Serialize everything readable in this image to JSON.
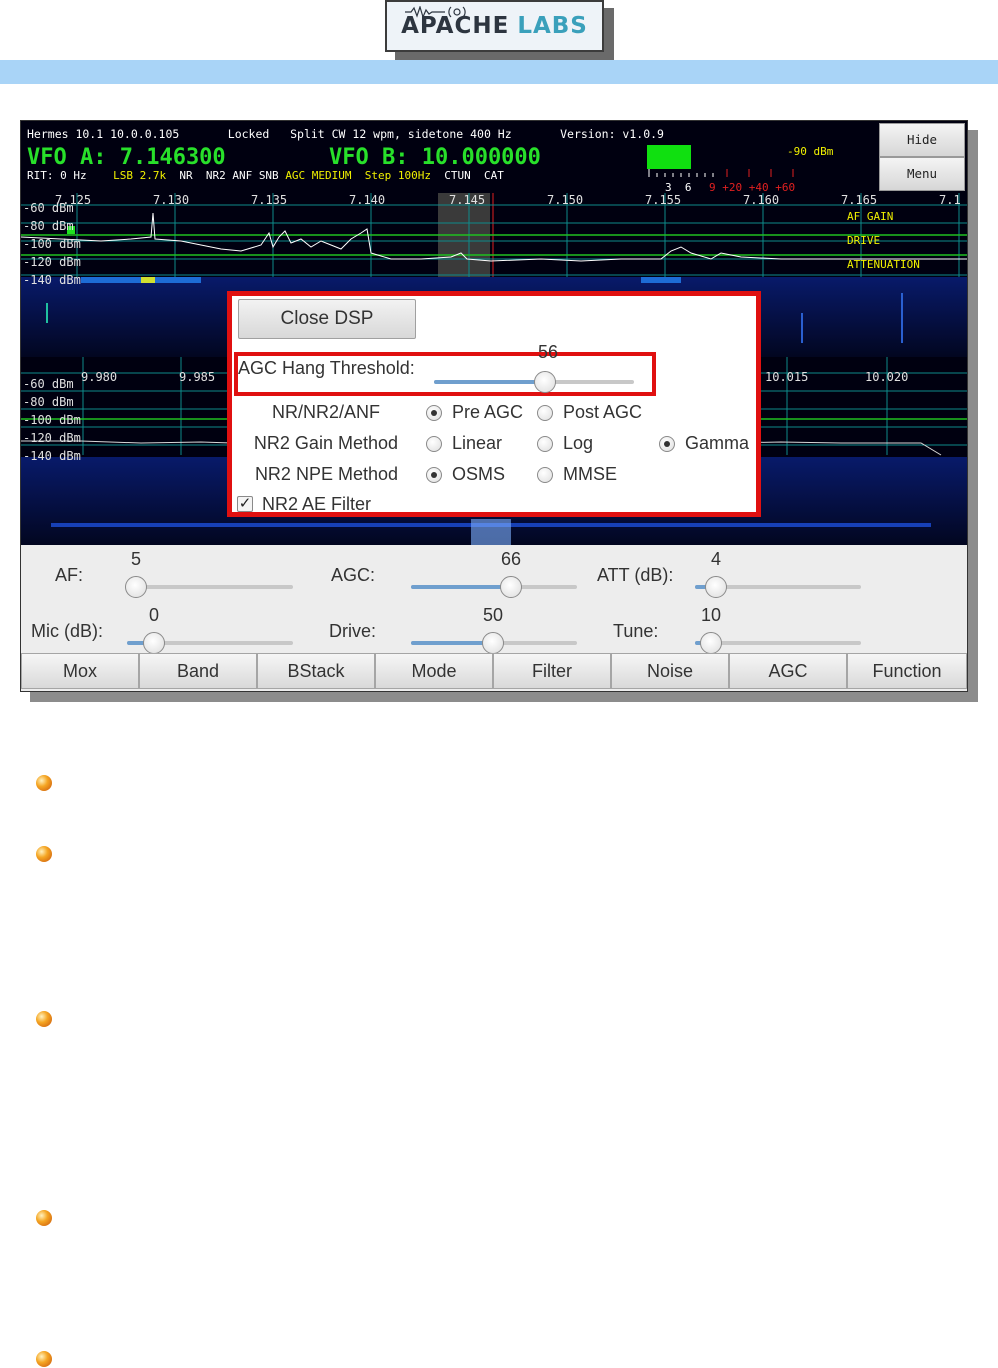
{
  "header": {
    "logo_text_a": "APACHE",
    "logo_text_b": "LABS"
  },
  "radio": {
    "status_line": "Hermes 10.1 10.0.0.105       Locked   Split CW 12 wpm, sidetone 400 Hz       Version: v1.0.9",
    "vfo_a": "VFO A: 7.146300",
    "vfo_b": "VFO B: 10.000000",
    "rit": "RIT: 0 Hz",
    "mode": "LSB 2.7k",
    "flags_1": "NR  NR2 ANF SNB",
    "agc": "AGC MEDIUM",
    "step": "Step 100Hz",
    "flags_2": "CTUN  CAT",
    "smeter_dbm": "-90 dBm",
    "smeter_scale_white": "3  6",
    "smeter_scale_red": "9 +20 +40 +60",
    "top_freqs": [
      "7.125",
      "7.130",
      "7.135",
      "7.140",
      "7.145",
      "7.150",
      "7.155",
      "7.160",
      "7.165",
      "7.1"
    ],
    "top_dbm": [
      "-60 dBm",
      "-80 dBm",
      "-100 dBm",
      "-120 dBm",
      "-140 dBm"
    ],
    "overlay_labels": [
      "AF GAIN",
      "DRIVE",
      "ATTENUATION"
    ],
    "bottom_freqs": [
      "9.980",
      "9.985",
      "10.015",
      "10.020"
    ],
    "bottom_dbm": [
      "-60 dBm",
      "-80 dBm",
      "-100 dBm",
      "-120 dBm",
      "-140 dBm"
    ]
  },
  "side_buttons": {
    "hide": "Hide",
    "menu": "Menu"
  },
  "dsp": {
    "close_label": "Close DSP",
    "hang_label": "AGC Hang Threshold:",
    "hang_value": "56",
    "hang_fraction": 0.55,
    "rows": [
      {
        "label": "NR/NR2/ANF",
        "options": [
          "Pre AGC",
          "Post AGC"
        ],
        "selected": 0
      },
      {
        "label": "NR2 Gain Method",
        "options": [
          "Linear",
          "Log",
          "Gamma"
        ],
        "selected": 2
      },
      {
        "label": "NR2 NPE Method",
        "options": [
          "OSMS",
          "MMSE"
        ],
        "selected": 0
      }
    ],
    "ae_filter_label": "NR2 AE Filter",
    "ae_filter_checked": true
  },
  "controls": {
    "af": {
      "label": "AF:",
      "value": "5",
      "fraction": 0.05
    },
    "agc": {
      "label": "AGC:",
      "value": "66",
      "fraction": 0.73
    },
    "att": {
      "label": "ATT (dB):",
      "value": "4",
      "fraction": 0.13
    },
    "mic": {
      "label": "Mic (dB):",
      "value": "0",
      "fraction": 0.17
    },
    "drive": {
      "label": "Drive:",
      "value": "50",
      "fraction": 0.5
    },
    "tune": {
      "label": "Tune:",
      "value": "10",
      "fraction": 0.1
    }
  },
  "bottom_buttons": [
    "Mox",
    "Band",
    "BStack",
    "Mode",
    "Filter",
    "Noise",
    "AGC",
    "Function"
  ],
  "colors": {
    "vfo_green": "#28e02a",
    "highlight_red": "#e01010",
    "header_blue": "#a9d4f7",
    "slider_blue": "#6f9fce"
  }
}
